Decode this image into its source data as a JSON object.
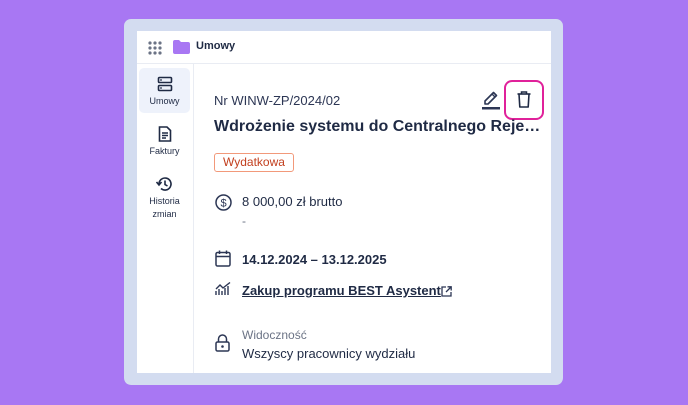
{
  "app": {
    "title": "Umowy",
    "accent": "#a877f3"
  },
  "sidebar": {
    "items": [
      {
        "label": "Umowy",
        "icon": "contracts-icon",
        "active": true
      },
      {
        "label": "Faktury",
        "icon": "invoice-icon",
        "active": false
      },
      {
        "label_line1": "Historia",
        "label_line2": "zmian",
        "icon": "history-icon",
        "active": false
      }
    ]
  },
  "contract": {
    "number": "Nr WINW-ZP/2024/02",
    "title": "Wdrożenie systemu do Centralnego Rejes...",
    "badge": "Wydatkowa",
    "amount": "8 000,00 zł brutto",
    "amount_sub": "-",
    "dates": "14.12.2024 – 13.12.2025",
    "program_link": "Zakup programu BEST Asystent",
    "visibility_label": "Widoczność",
    "visibility_value": "Wszyscy pracownicy wydziału"
  },
  "actions": {
    "edit": "edit-icon",
    "delete": "trash-icon",
    "highlight_color": "#e0219a"
  }
}
